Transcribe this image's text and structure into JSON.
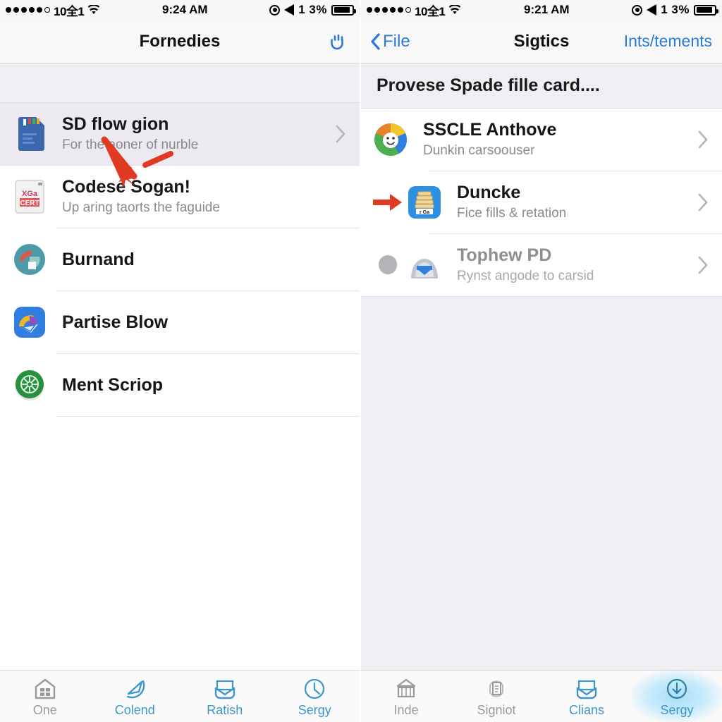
{
  "colors": {
    "accent_blue": "#2a7bd6",
    "tab_blue": "#3f96c8",
    "tab_gray": "#9a9a9e",
    "annotation_red": "#e03a22",
    "section_bg": "#eeeef3",
    "selected_row_bg": "#eceaf0"
  },
  "left": {
    "statusbar": {
      "carrier": "10全1",
      "time": "9:24 AM",
      "battery_percent": "1 3%",
      "signal_dots_filled": 5,
      "signal_dots_total": 6,
      "wifi_icon": "wifi-icon",
      "location_icon": "location-ring-icon",
      "navigation_icon": "navigation-arrow-icon",
      "battery_icon": "battery-icon"
    },
    "navbar": {
      "title": "Fornedies",
      "right_icon": "hand-palm-icon"
    },
    "section_header": "",
    "rows": [
      {
        "title": "SD flow gion",
        "subtitle": "For the aoner of nurble",
        "icon": "sd-card-icon",
        "chevron": "chevron-right-icon",
        "selected": true
      },
      {
        "title": "Codese Sogan!",
        "subtitle": "Up aring taorts the faguide",
        "icon": "document-thumbnail-icon",
        "chevron": "",
        "selected": false
      },
      {
        "title": "Burnand",
        "subtitle": "",
        "icon": "teal-circle-icon",
        "chevron": "",
        "selected": false
      },
      {
        "title": "Partise Blow",
        "subtitle": "",
        "icon": "blue-rounded-square-icon",
        "chevron": "",
        "selected": false
      },
      {
        "title": "Ment Scriop",
        "subtitle": "",
        "icon": "green-wheel-icon",
        "chevron": "",
        "selected": false
      }
    ],
    "tabs": [
      {
        "label": "One",
        "icon": "home-icon",
        "state": "gray"
      },
      {
        "label": "Colend",
        "icon": "compass-icon",
        "state": "blue"
      },
      {
        "label": "Ratish",
        "icon": "inbox-icon",
        "state": "blue"
      },
      {
        "label": "Sergy",
        "icon": "clock-icon",
        "state": "blue"
      }
    ]
  },
  "right": {
    "statusbar": {
      "carrier": "10全1",
      "time": "9:21 AM",
      "battery_percent": "1 3%",
      "signal_dots_filled": 5,
      "signal_dots_total": 6,
      "wifi_icon": "wifi-icon",
      "location_icon": "location-ring-icon",
      "navigation_icon": "navigation-arrow-icon",
      "battery_icon": "battery-icon"
    },
    "navbar": {
      "back_label": "File",
      "back_icon": "chevron-left-icon",
      "title": "Sigtics",
      "right_label": "Ints/tements"
    },
    "section_header": "Provese Spade fille card....",
    "rows": [
      {
        "title": "SSCLE Anthove",
        "subtitle": "Dunkin carsoouser",
        "icon": "colorful-ring-avatar-icon",
        "chevron": "chevron-right-icon",
        "marker": "",
        "dim": false
      },
      {
        "title": "Duncke",
        "subtitle": "Fice fills & retation",
        "icon": "blue-file-stack-icon",
        "chevron": "chevron-right-icon",
        "marker": "red-arrow-marker",
        "dim": false
      },
      {
        "title": "Tophew PD",
        "subtitle": "Rynst angode to carsid",
        "icon": "gray-envelope-icon",
        "chevron": "chevron-right-icon",
        "marker": "gray-blob-marker",
        "dim": true
      }
    ],
    "tabs": [
      {
        "label": "Inde",
        "icon": "bank-icon",
        "state": "gray"
      },
      {
        "label": "Signiot",
        "icon": "document-icon",
        "state": "gray"
      },
      {
        "label": "Clians",
        "icon": "inbox-icon",
        "state": "blue"
      },
      {
        "label": "Sergy",
        "icon": "download-circle-icon",
        "state": "blue-glow"
      }
    ]
  },
  "annotations": [
    {
      "name": "red-arrow-pointer",
      "panel": "left"
    },
    {
      "name": "red-arrow-dash",
      "panel": "left"
    }
  ]
}
